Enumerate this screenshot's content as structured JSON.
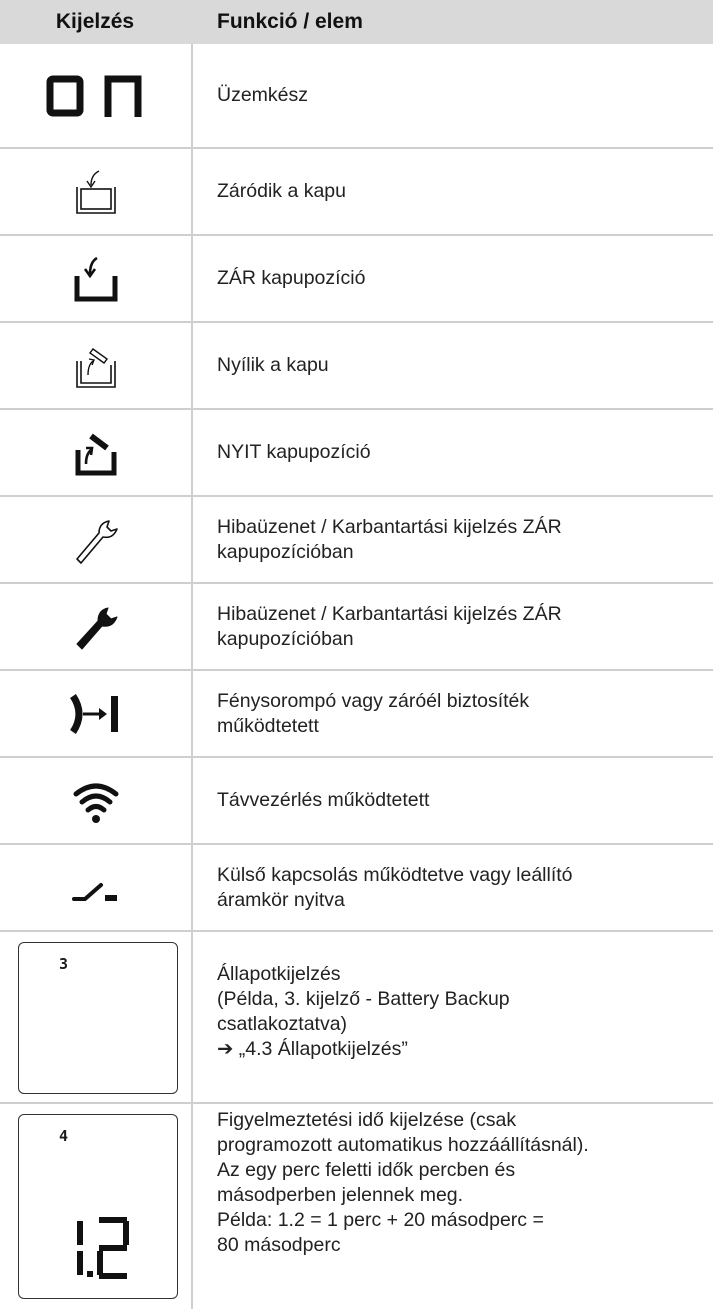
{
  "header": {
    "col1": "Kijelzés",
    "col2": "Funkció / elem"
  },
  "rows": [
    {
      "icon": "on-display-icon",
      "text": "Üzemkész"
    },
    {
      "icon": "gate-closing-icon",
      "text": "Záródik a kapu"
    },
    {
      "icon": "gate-closed-position-icon",
      "text": "ZÁR kapupozíció"
    },
    {
      "icon": "gate-opening-icon",
      "text": "Nyílik a kapu"
    },
    {
      "icon": "gate-open-position-icon",
      "text": "NYIT kapupozíció"
    },
    {
      "icon": "wrench-outline-icon",
      "text": "Hibaüzenet / Karbantartási kijelzés ZÁR\nkapupozícióban"
    },
    {
      "icon": "wrench-filled-icon",
      "text": "Hibaüzenet / Karbantartási kijelzés ZÁR\nkapupozícióban"
    },
    {
      "icon": "light-barrier-icon",
      "text": "Fénysorompó vagy záróél biztosíték\nműködtetett"
    },
    {
      "icon": "wifi-icon",
      "text": "Távvezérlés működtetett"
    },
    {
      "icon": "switch-icon",
      "text": "Külső kapcsolás működtetve vagy leállító\náramkör nyitva"
    },
    {
      "icon": "status-display-icon",
      "lcd_digit": "3",
      "text": "Állapotkijelzés\n(Példa, 3. kijelző - Battery Backup\ncsatlakoztatva)\n➔  „4.3 Állapotkijelzés”"
    },
    {
      "icon": "warning-time-display-icon",
      "lcd_digit": "4",
      "lcd_value": "1.2",
      "text": "Figyelmeztetési idő kijelzése (csak\nprogramozott automatikus hozzáállításnál).\nAz egy perc feletti idők percben és\nmásodperben jelennek meg.\nPélda: 1.2 = 1 perc + 20 másodperc =\n80 másodperc"
    }
  ]
}
